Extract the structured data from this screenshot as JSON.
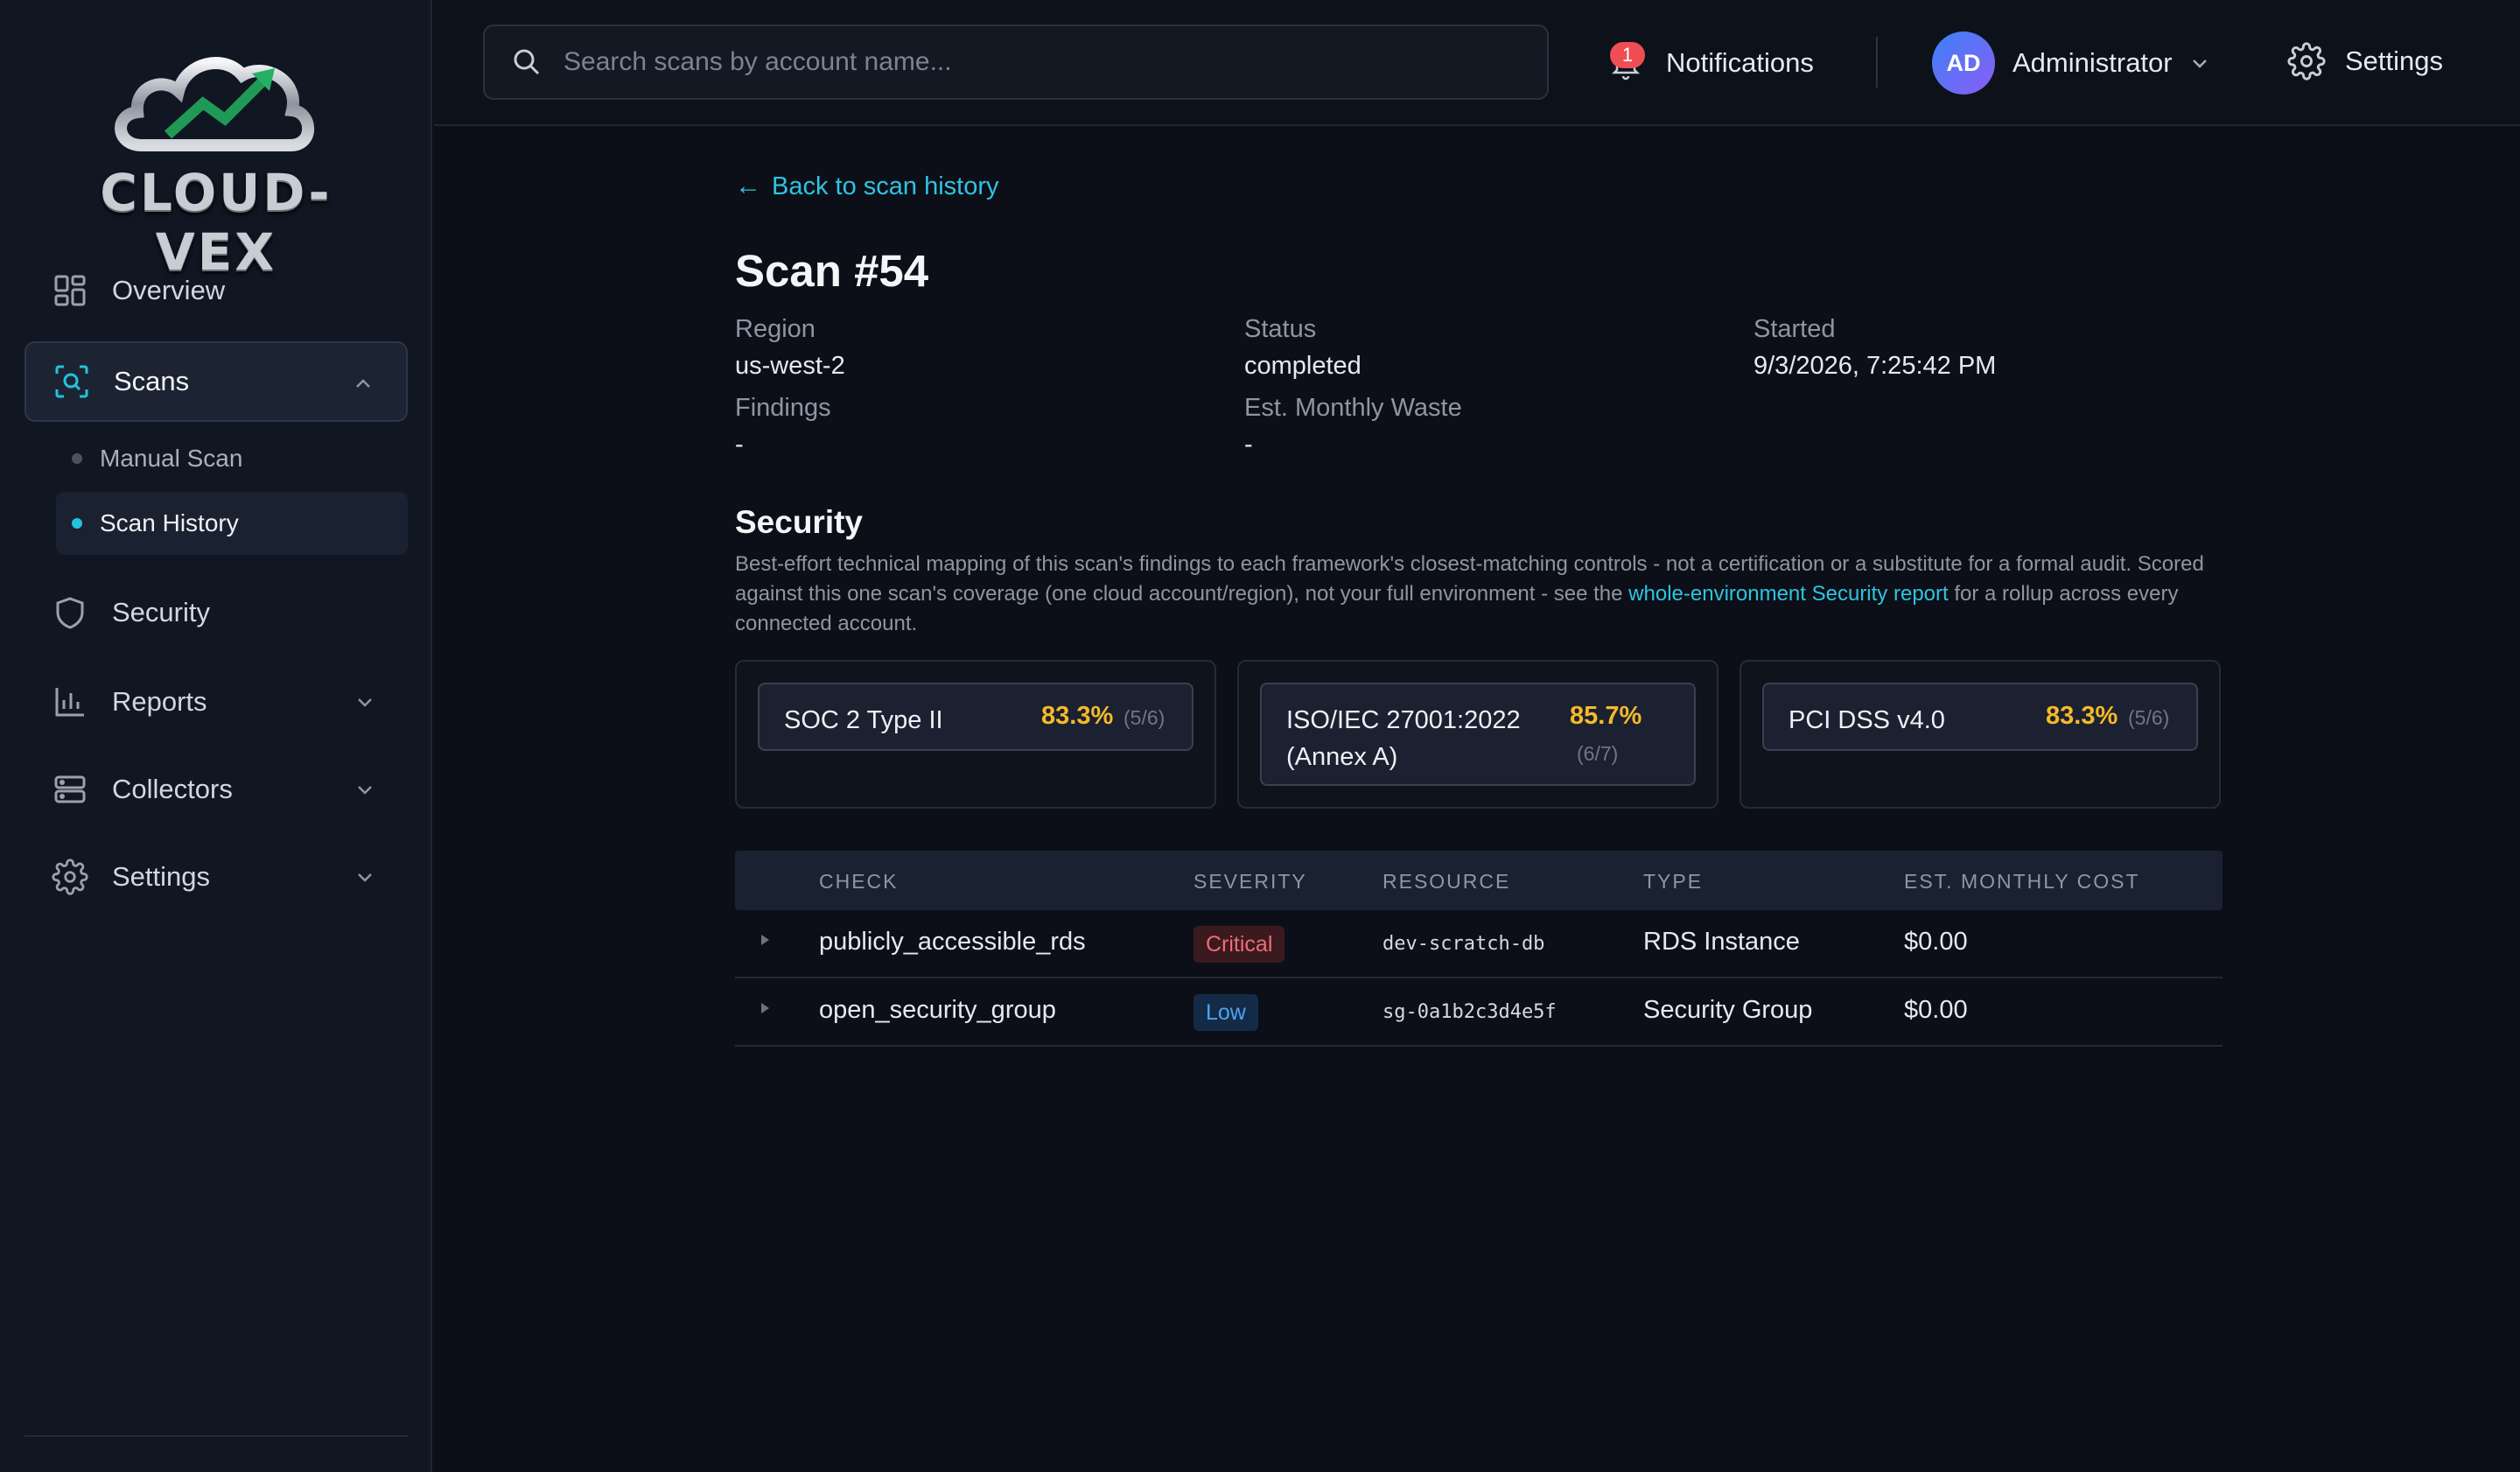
{
  "app": {
    "logo_text": "CLOUD-VEX"
  },
  "sidebar": {
    "items": [
      {
        "label": "Overview",
        "icon": "grid-icon"
      },
      {
        "label": "Scans",
        "icon": "scan-icon",
        "active": true,
        "expanded": true
      },
      {
        "label": "Security",
        "icon": "shield-icon"
      },
      {
        "label": "Reports",
        "icon": "bar-chart-icon"
      },
      {
        "label": "Collectors",
        "icon": "server-icon"
      },
      {
        "label": "Settings",
        "icon": "gear-icon"
      }
    ],
    "scan_subitems": [
      {
        "label": "Manual Scan"
      },
      {
        "label": "Scan History",
        "active": true
      }
    ]
  },
  "header": {
    "search_placeholder": "Search scans by account name...",
    "notifications_label": "Notifications",
    "notifications_count": "1",
    "user_initials": "AD",
    "user_name": "Administrator",
    "settings_label": "Settings"
  },
  "scan": {
    "back_label": "Back to scan history",
    "title": "Scan #54",
    "region_label": "Region",
    "region": "us-west-2",
    "status_label": "Status",
    "status": "completed",
    "started_label": "Started",
    "started": "9/3/2026, 7:25:42 PM",
    "findings_label": "Findings",
    "findings": "-",
    "waste_label": "Est. Monthly Waste",
    "waste": "-"
  },
  "security": {
    "title": "Security",
    "desc_before": "Best-effort technical mapping of this scan's findings to each framework's closest-matching controls - not a certification or a substitute for a formal audit. Scored against this one scan's coverage (one cloud account/region), not your full environment - see the ",
    "desc_link": "whole-environment Security report",
    "desc_after": " for a rollup across every connected account.",
    "frameworks": [
      {
        "name": "SOC 2 Type II",
        "pct": "83.3%",
        "ratio": "(5/6)"
      },
      {
        "name": "ISO/IEC 27001:2022 (Annex A)",
        "pct": "85.7%",
        "ratio": "(6/7)"
      },
      {
        "name": "PCI DSS v4.0",
        "pct": "83.3%",
        "ratio": "(5/6)"
      }
    ],
    "accent_color": "#f5b92a"
  },
  "findings_table": {
    "columns": [
      "CHECK",
      "SEVERITY",
      "RESOURCE",
      "TYPE",
      "EST. MONTHLY COST"
    ],
    "rows": [
      {
        "check": "publicly_accessible_rds",
        "severity": "Critical",
        "resource": "dev-scratch-db",
        "type": "RDS Instance",
        "cost": "$0.00"
      },
      {
        "check": "open_security_group",
        "severity": "Low",
        "resource": "sg-0a1b2c3d4e5f",
        "type": "Security Group",
        "cost": "$0.00"
      }
    ]
  }
}
